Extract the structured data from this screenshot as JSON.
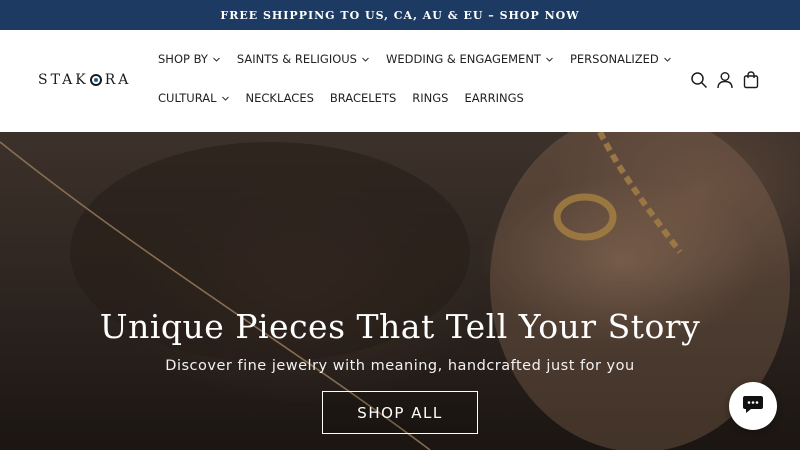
{
  "announcement": {
    "text": "FREE SHIPPING TO US, CA, AU & EU – SHOP NOW"
  },
  "brand": {
    "logo_left": "STAK",
    "logo_right": "RA",
    "accent": "#1d3a62"
  },
  "nav": {
    "row1": [
      {
        "label": "SHOP BY",
        "dropdown": true
      },
      {
        "label": "SAINTS & RELIGIOUS",
        "dropdown": true
      },
      {
        "label": "WEDDING & ENGAGEMENT",
        "dropdown": true
      },
      {
        "label": "PERSONALIZED",
        "dropdown": true
      }
    ],
    "row2": [
      {
        "label": "CULTURAL",
        "dropdown": true
      },
      {
        "label": "NECKLACES",
        "dropdown": false
      },
      {
        "label": "BRACELETS",
        "dropdown": false
      },
      {
        "label": "RINGS",
        "dropdown": false
      },
      {
        "label": "EARRINGS",
        "dropdown": false
      }
    ]
  },
  "header_icons": [
    "search-icon",
    "account-icon",
    "cart-icon"
  ],
  "hero": {
    "title": "Unique Pieces That Tell Your Story",
    "subtitle": "Discover fine jewelry with meaning, handcrafted just for you",
    "button": "SHOP ALL"
  },
  "chat": {
    "icon": "chat-icon"
  }
}
